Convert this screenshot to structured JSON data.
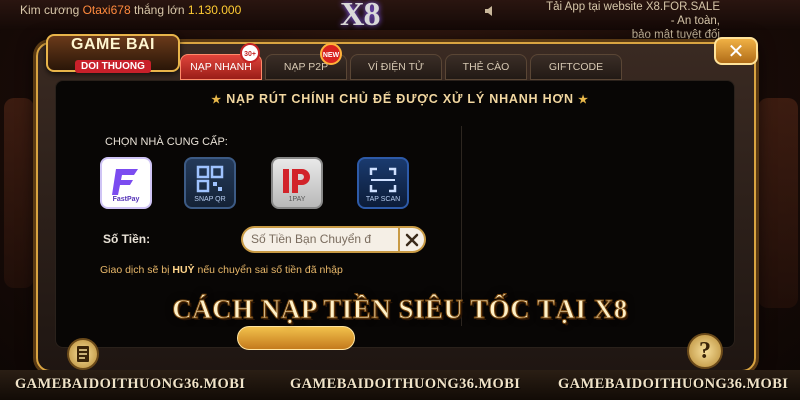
{
  "top": {
    "marquee_prefix": "Kim cương",
    "marquee_nick": "Otaxi678",
    "marquee_mid": "thắng lớn",
    "marquee_amount": "1.130.000",
    "logo": "X8",
    "notice_line1": "Tải App tại website X8.FOR.SALE - An toàn,",
    "notice_line2": "bảo mật tuyệt đối"
  },
  "brand": {
    "line1": "GAME BAI",
    "line2": "DOI THUONG"
  },
  "tabs": [
    {
      "label": "NẠP NHANH",
      "badge": "30+",
      "active": true
    },
    {
      "label": "NẠP P2P",
      "badge": "NEW",
      "active": false
    },
    {
      "label": "VÍ ĐIỆN TỬ",
      "active": false
    },
    {
      "label": "THẺ CÀO",
      "active": false
    },
    {
      "label": "GIFTCODE",
      "active": false
    }
  ],
  "headline": "NẠP RÚT CHÍNH CHỦ ĐỂ ĐƯỢC XỬ LÝ NHANH HƠN",
  "provider_label": "CHỌN NHÀ CUNG CẤP:",
  "providers": [
    {
      "name": "FastPay",
      "icon": "fastpay-icon"
    },
    {
      "name": "SNAP QR",
      "icon": "qr-icon"
    },
    {
      "name": "1PAY",
      "icon": "1pay-icon"
    },
    {
      "name": "TAP SCAN",
      "icon": "scan-icon"
    }
  ],
  "amount": {
    "label": "Số Tiền:",
    "placeholder": "Số Tiền Bạn Chuyển đ"
  },
  "warning": {
    "prefix": "Giao dịch sẽ bị",
    "bold": "HUỶ",
    "suffix": "nếu chuyển sai số tiền đã nhập"
  },
  "overlay_title": "CÁCH NẠP TIỀN SIÊU TỐC TẠI X8",
  "footer": [
    "GAMEBAIDOITHUONG36.MOBI",
    "GAMEBAIDOITHUONG36.MOBI",
    "GAMEBAIDOITHUONG36.MOBI"
  ],
  "colors": {
    "accent": "#d9a441",
    "active_tab": "#c8231d",
    "headline": "#f2d7a0",
    "warning": "#e9b86a"
  }
}
